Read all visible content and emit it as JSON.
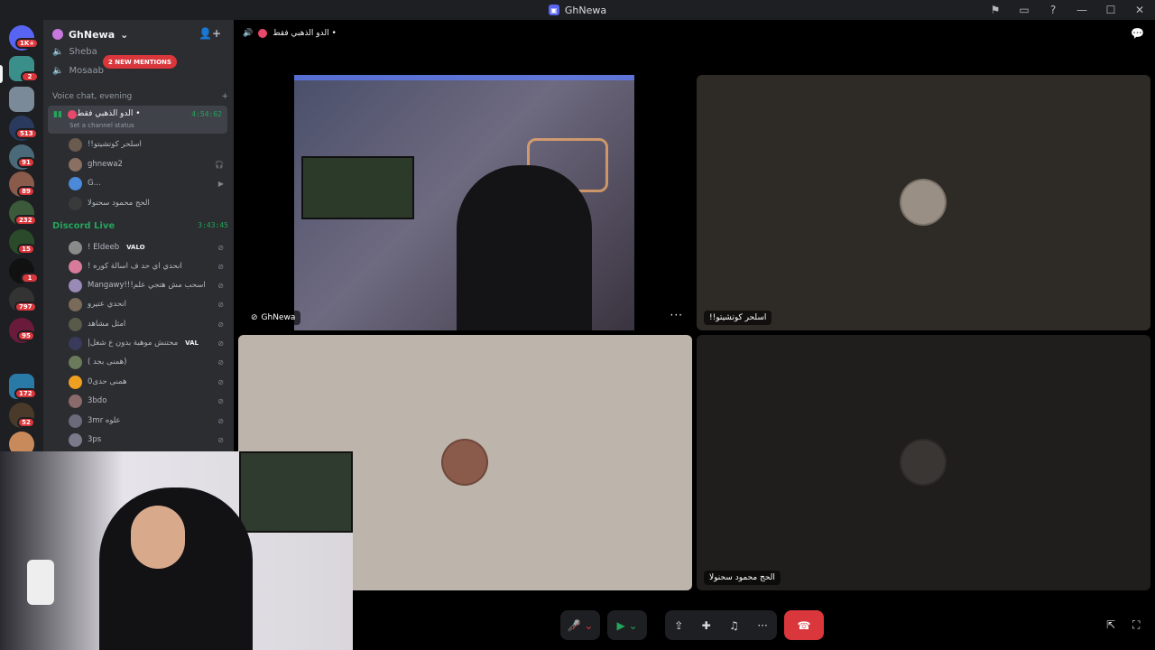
{
  "window": {
    "title": "GhNewa"
  },
  "server_list": {
    "home_badge": "1K+",
    "badges": [
      "2",
      "513",
      "91",
      "89",
      "232",
      "15",
      "1",
      "797",
      "95",
      "172",
      "52"
    ]
  },
  "sidebar": {
    "server_name": "GhNewa",
    "channels": [
      {
        "name": "Sheba"
      },
      {
        "name": "Mosaab"
      }
    ],
    "mentions_label": "2 NEW MENTIONS",
    "category": "Voice chat, evening",
    "active_voice": {
      "name": "الدو الذهبي فقط •",
      "timer": "4:54:62",
      "status": "Set a channel status",
      "members": [
        "!!اسلحر كوتشيتو",
        "ghnewa2",
        "G...",
        "الحج محمود سحنولا"
      ]
    },
    "live_voice": {
      "name": "Discord Live",
      "timer": "3:43:45",
      "members": [
        {
          "name": "! Eldeeb",
          "tag": "VALO"
        },
        {
          "name": "! انحدي اي حد ف اسالة كوره",
          "tag": ""
        },
        {
          "name": "Mangawy!!!اسحب مش هتجي علم",
          "tag": ""
        },
        {
          "name": "انحدي عتيرو",
          "tag": ""
        },
        {
          "name": "امثل مشاهد",
          "tag": ""
        },
        {
          "name": "|محتنش موهبة بدون ع شغل",
          "tag": "VAL"
        },
        {
          "name": "( همنى بجد)",
          "tag": ""
        },
        {
          "name": "0همنى حدى",
          "tag": ""
        },
        {
          "name": "3bdo",
          "tag": ""
        },
        {
          "name": "3mr علوه",
          "tag": ""
        },
        {
          "name": "3ps",
          "tag": ""
        }
      ]
    }
  },
  "stage": {
    "channel_title": "الدو الذهبي فقط •",
    "tiles": [
      {
        "label": "GhNewa",
        "type": "video"
      },
      {
        "label": "!!اسلحر كوتشيتو",
        "type": "avatar",
        "bg": "#2e2a25"
      },
      {
        "label": "",
        "type": "avatar",
        "bg": "#bdb5ab"
      },
      {
        "label": "الحج محمود سحنولا",
        "type": "avatar",
        "bg": "#1f1e1c"
      }
    ]
  },
  "colors": {
    "accent": "#5865f2",
    "live": "#23a55a",
    "danger": "#da373c"
  }
}
